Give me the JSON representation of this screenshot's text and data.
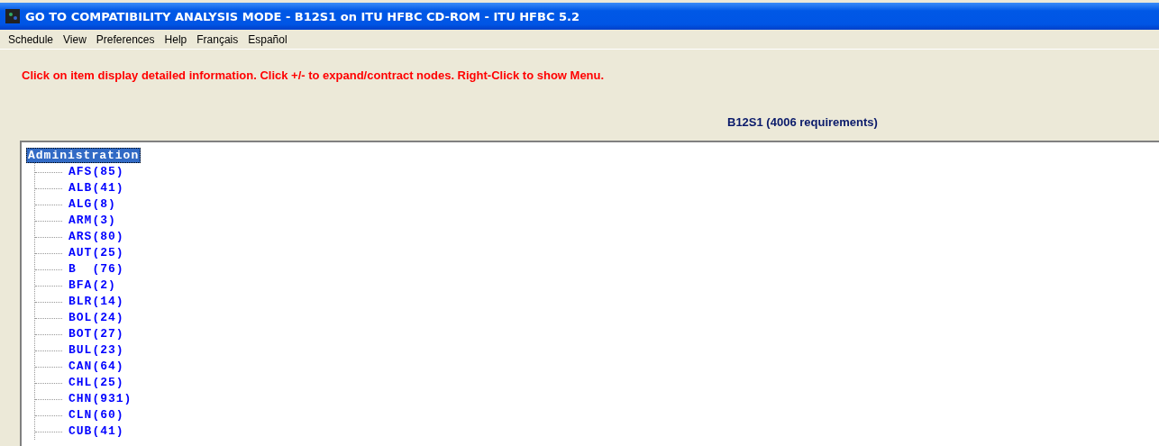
{
  "window": {
    "title": "GO TO  COMPATIBILITY ANALYSIS MODE - B12S1 on ITU HFBC CD-ROM - ITU HFBC 5.2"
  },
  "menu": [
    "Schedule",
    "View",
    "Preferences",
    "Help",
    "Français",
    "Español"
  ],
  "instruction": "Click on item display detailed information. Click +/- to expand/contract nodes. Right-Click to show Menu.",
  "summary": "B12S1 (4006 requirements)",
  "tree": {
    "label": "Administration",
    "selected": true,
    "children": [
      {
        "label": "AFS(85)",
        "selected": false
      },
      {
        "label": "ALB(41)",
        "selected": false
      },
      {
        "label": "ALG(8)",
        "selected": false
      },
      {
        "label": "ARM(3)",
        "selected": false
      },
      {
        "label": "ARS(80)",
        "selected": false
      },
      {
        "label": "AUT(25)",
        "selected": false
      },
      {
        "label": "B  (76)",
        "selected": false
      },
      {
        "label": "BFA(2)",
        "selected": false
      },
      {
        "label": "BLR(14)",
        "selected": false
      },
      {
        "label": "BOL(24)",
        "selected": false
      },
      {
        "label": "BOT(27)",
        "selected": false
      },
      {
        "label": "BUL(23)",
        "selected": false
      },
      {
        "label": "CAN(64)",
        "selected": false
      },
      {
        "label": "CHL(25)",
        "selected": false
      },
      {
        "label": "CHN(931)",
        "selected": false
      },
      {
        "label": "CLN(60)",
        "selected": false
      },
      {
        "label": "CUB(41)",
        "selected": false
      }
    ]
  }
}
